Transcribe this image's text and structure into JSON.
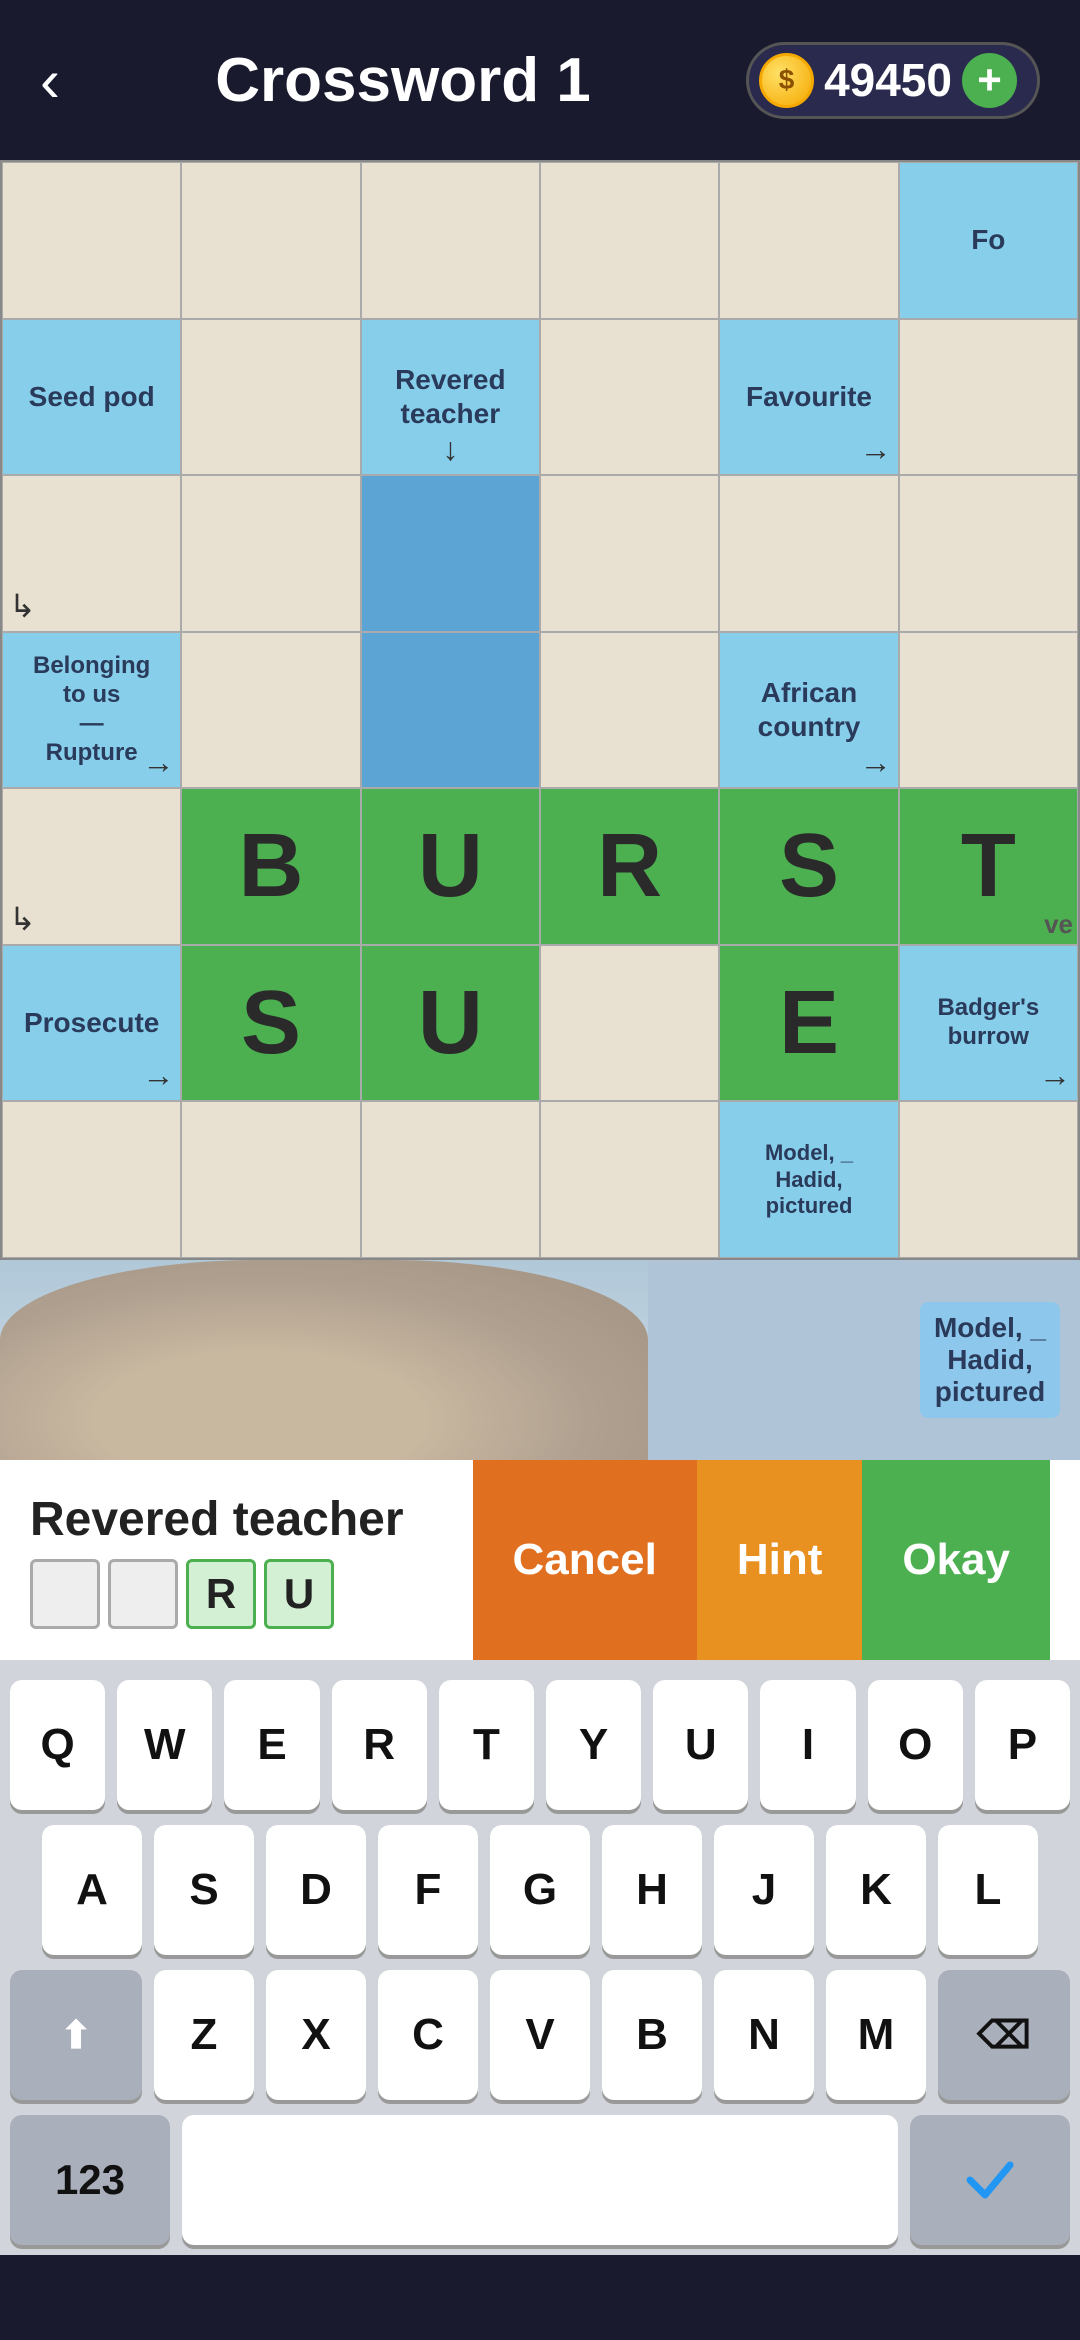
{
  "header": {
    "back_label": "‹",
    "title": "Crossword 1",
    "coin_icon": "🪙",
    "coin_amount": "49450",
    "add_label": "+"
  },
  "grid": {
    "rows": [
      [
        {
          "type": "beige",
          "content": ""
        },
        {
          "type": "beige",
          "content": ""
        },
        {
          "type": "beige",
          "content": ""
        },
        {
          "type": "beige",
          "content": ""
        },
        {
          "type": "beige",
          "content": ""
        },
        {
          "type": "light-blue",
          "content": "Fo",
          "partial": true
        }
      ],
      [
        {
          "type": "light-blue",
          "content": "Seed pod",
          "clue": true
        },
        {
          "type": "beige",
          "content": ""
        },
        {
          "type": "light-blue",
          "content": "Revered\nteacher",
          "clue": true,
          "arrow": "down"
        },
        {
          "type": "beige",
          "content": ""
        },
        {
          "type": "light-blue",
          "content": "Favourite",
          "clue": true,
          "arrow": "right"
        },
        {
          "type": "beige",
          "content": ""
        }
      ],
      [
        {
          "type": "beige",
          "content": "",
          "arrow": "corner"
        },
        {
          "type": "beige",
          "content": ""
        },
        {
          "type": "blue",
          "content": ""
        },
        {
          "type": "beige",
          "content": ""
        },
        {
          "type": "beige",
          "content": ""
        },
        {
          "type": "beige",
          "content": ""
        }
      ],
      [
        {
          "type": "light-blue",
          "content": "Belonging\nto us\n—\nRupture",
          "clue": true,
          "arrow": "right"
        },
        {
          "type": "beige",
          "content": ""
        },
        {
          "type": "blue",
          "content": ""
        },
        {
          "type": "beige",
          "content": ""
        },
        {
          "type": "light-blue",
          "content": "African\ncountry",
          "clue": true,
          "arrow": "right"
        },
        {
          "type": "beige",
          "content": ""
        }
      ],
      [
        {
          "type": "beige",
          "content": "",
          "arrow": "corner"
        },
        {
          "type": "green",
          "letter": "B"
        },
        {
          "type": "green",
          "letter": "U"
        },
        {
          "type": "green",
          "letter": "R"
        },
        {
          "type": "green",
          "letter": "S"
        },
        {
          "type": "green",
          "letter": "T",
          "partial_right": "ve"
        }
      ],
      [
        {
          "type": "light-blue",
          "content": "Prosecute",
          "clue": true,
          "arrow": "right"
        },
        {
          "type": "green",
          "letter": "S"
        },
        {
          "type": "green",
          "letter": "U"
        },
        {
          "type": "beige",
          "content": ""
        },
        {
          "type": "green",
          "letter": "E"
        },
        {
          "type": "light-blue",
          "content": "Badger's\nburrow",
          "clue": true,
          "arrow": "right"
        }
      ],
      [
        {
          "type": "beige",
          "content": ""
        },
        {
          "type": "beige",
          "content": ""
        },
        {
          "type": "beige",
          "content": ""
        },
        {
          "type": "beige",
          "content": ""
        },
        {
          "type": "light-blue",
          "content": "Model, _\nHadid,\npictured",
          "clue": true
        },
        {
          "type": "beige",
          "content": ""
        }
      ]
    ]
  },
  "clue_bar": {
    "question": "Revered teacher",
    "answer_boxes": [
      "",
      "",
      "R",
      "U"
    ],
    "cancel_label": "Cancel",
    "hint_label": "Hint",
    "okay_label": "Okay"
  },
  "keyboard": {
    "row1": [
      "Q",
      "W",
      "E",
      "R",
      "T",
      "Y",
      "U",
      "I",
      "O",
      "P"
    ],
    "row2": [
      "A",
      "S",
      "D",
      "F",
      "G",
      "H",
      "J",
      "K",
      "L"
    ],
    "row3_shift": "⬆",
    "row3": [
      "Z",
      "X",
      "C",
      "V",
      "B",
      "N",
      "M"
    ],
    "row3_delete": "⌫",
    "bottom_123": "123",
    "bottom_check_color": "#2196F3"
  }
}
